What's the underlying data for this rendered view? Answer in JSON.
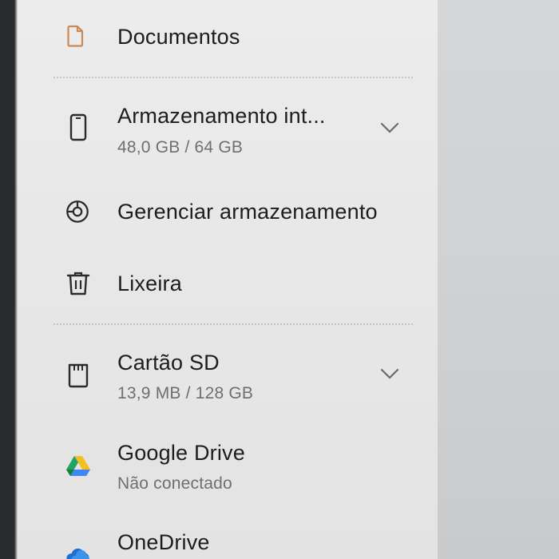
{
  "drawer": {
    "items": [
      {
        "title": "Documentos",
        "icon": "document-icon"
      },
      {
        "title": "Armazenamento int...",
        "subtitle": "48,0 GB / 64 GB",
        "icon": "phone-storage-icon",
        "expandable": true
      },
      {
        "title": "Gerenciar armazenamento",
        "icon": "storage-analytics-icon"
      },
      {
        "title": "Lixeira",
        "icon": "trash-icon"
      },
      {
        "title": "Cartão SD",
        "subtitle": "13,9 MB / 128 GB",
        "icon": "sd-card-icon",
        "expandable": true
      },
      {
        "title": "Google Drive",
        "subtitle": "Não conectado",
        "icon": "google-drive-icon"
      },
      {
        "title": "OneDrive",
        "icon": "onedrive-icon"
      }
    ]
  },
  "colors": {
    "document_icon": "#c98a55",
    "text_primary": "#1d1d1f",
    "text_secondary": "#6f6f72"
  }
}
